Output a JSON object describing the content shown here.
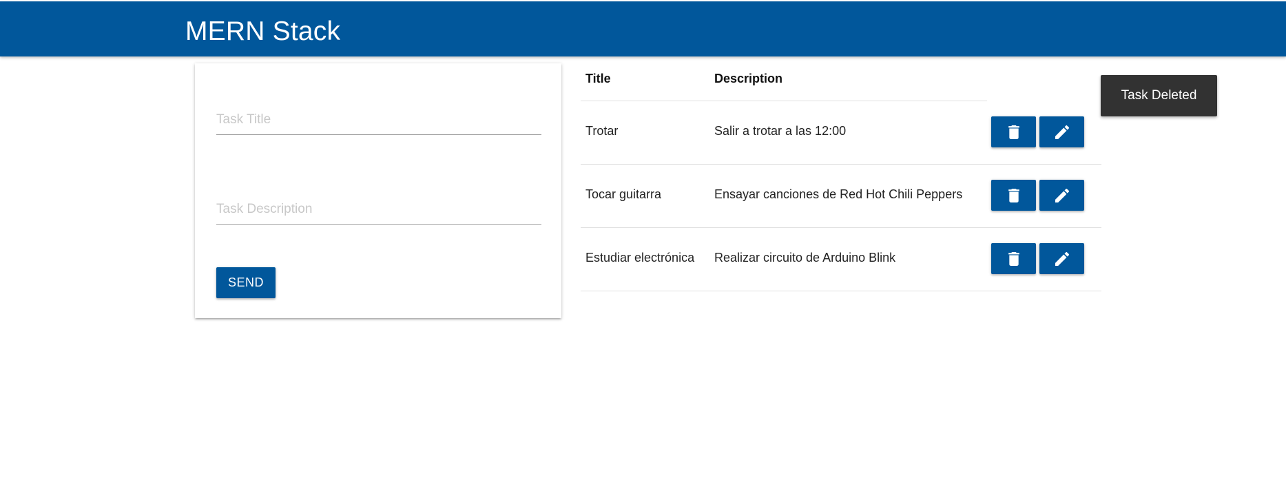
{
  "navbar": {
    "brand": "MERN Stack"
  },
  "form": {
    "title_placeholder": "Task Title",
    "title_value": "",
    "description_placeholder": "Task Description",
    "description_value": "",
    "send_label": "SEND"
  },
  "table": {
    "headers": {
      "title": "Title",
      "description": "Description"
    },
    "rows": [
      {
        "title": "Trotar",
        "description": "Salir a trotar a las 12:00",
        "delete_icon": "trash-icon",
        "edit_icon": "pencil-icon"
      },
      {
        "title": "Tocar guitarra",
        "description": "Ensayar canciones de Red Hot Chili Peppers",
        "delete_icon": "trash-icon",
        "edit_icon": "pencil-icon"
      },
      {
        "title": "Estudiar electrónica",
        "description": "Realizar circuito de Arduino Blink",
        "delete_icon": "trash-icon",
        "edit_icon": "pencil-icon"
      }
    ]
  },
  "toast": {
    "message": "Task Deleted"
  },
  "colors": {
    "primary": "#01579b",
    "toast_bg": "#323232"
  }
}
